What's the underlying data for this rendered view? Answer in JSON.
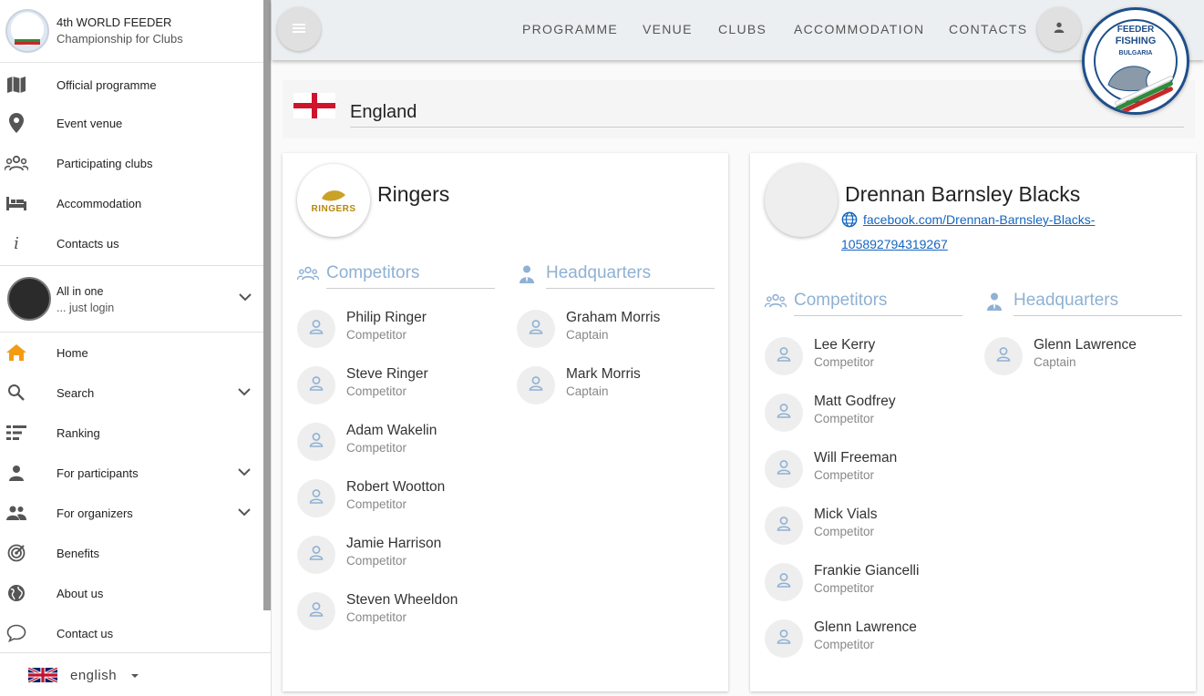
{
  "brand": {
    "title": "4th WORLD FEEDER",
    "subtitle": "Championship for Clubs"
  },
  "sidebar": {
    "top_items": [
      {
        "label": "Official programme",
        "icon": "map-book-icon"
      },
      {
        "label": "Event venue",
        "icon": "location-pin-icon"
      },
      {
        "label": "Participating clubs",
        "icon": "group-icon"
      },
      {
        "label": "Accommodation",
        "icon": "bed-icon"
      },
      {
        "label": "Contacts us",
        "icon": "info-icon"
      }
    ],
    "user": {
      "title": "All in one",
      "subtitle": "... just login"
    },
    "items": [
      {
        "label": "Home",
        "icon": "home-icon"
      },
      {
        "label": "Search",
        "icon": "search-icon"
      },
      {
        "label": "Ranking",
        "icon": "ranking-list-icon"
      },
      {
        "label": "For participants",
        "icon": "person-icon"
      },
      {
        "label": "For organizers",
        "icon": "people-icon"
      },
      {
        "label": "Benefits",
        "icon": "target-icon"
      },
      {
        "label": "About us",
        "icon": "globe-icon"
      },
      {
        "label": "Contact us",
        "icon": "chat-bubble-icon"
      }
    ],
    "language": "english"
  },
  "topbar": {
    "nav": [
      "PROGRAMME",
      "VENUE",
      "CLUBS",
      "ACCOMMODATION",
      "CONTACTS"
    ],
    "emblem": {
      "line1": "FEEDER",
      "line2": "FISHING",
      "line3": "BULGARIA"
    }
  },
  "country": {
    "name": "England"
  },
  "clubs": [
    {
      "name": "Ringers",
      "logo_text": "RINGERS",
      "competitors_label": "Competitors",
      "hq_label": "Headquarters",
      "competitors": [
        {
          "name": "Philip Ringer",
          "role": "Competitor"
        },
        {
          "name": "Steve Ringer",
          "role": "Competitor"
        },
        {
          "name": "Adam Wakelin",
          "role": "Competitor"
        },
        {
          "name": "Robert Wootton",
          "role": "Competitor"
        },
        {
          "name": "Jamie Harrison",
          "role": "Competitor"
        },
        {
          "name": "Steven Wheeldon",
          "role": "Competitor"
        }
      ],
      "headquarters": [
        {
          "name": "Graham Morris",
          "role": "Captain"
        },
        {
          "name": "Mark Morris",
          "role": "Captain"
        }
      ]
    },
    {
      "name": "Drennan Barnsley Blacks",
      "link": "facebook.com/Drennan-Barnsley-Blacks-105892794319267",
      "competitors_label": "Competitors",
      "hq_label": "Headquarters",
      "competitors": [
        {
          "name": "Lee Kerry",
          "role": "Competitor"
        },
        {
          "name": "Matt Godfrey",
          "role": "Competitor"
        },
        {
          "name": "Will Freeman",
          "role": "Competitor"
        },
        {
          "name": "Mick Vials",
          "role": "Competitor"
        },
        {
          "name": "Frankie Giancelli",
          "role": "Competitor"
        },
        {
          "name": "Glenn Lawrence",
          "role": "Competitor"
        }
      ],
      "headquarters": [
        {
          "name": "Glenn Lawrence",
          "role": "Captain"
        }
      ]
    }
  ]
}
